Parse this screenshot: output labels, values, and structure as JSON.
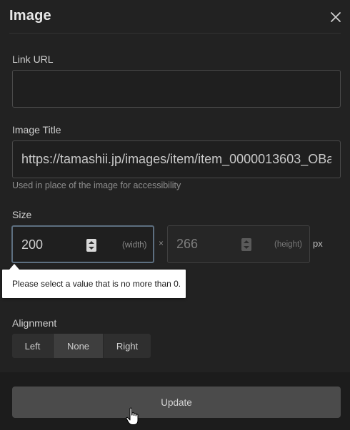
{
  "dialog": {
    "title": "Image"
  },
  "link": {
    "label": "Link URL",
    "value": "",
    "placeholder": ""
  },
  "image_title": {
    "label": "Image Title",
    "value": "https://tamashii.jp/images/item/item_0000013603_OBa",
    "hint": "Used in place of the image for accessibility"
  },
  "size": {
    "label": "Size",
    "width_value": "200",
    "width_note": "(width)",
    "separator": "×",
    "height_value": "266",
    "height_note": "(height)",
    "unit": "px"
  },
  "validation": {
    "message": "Please select a value that is no more than 0."
  },
  "alignment": {
    "label": "Alignment",
    "options": [
      "Left",
      "None",
      "Right"
    ],
    "selected": "None"
  },
  "footer": {
    "update_label": "Update"
  },
  "icons": {
    "close": "close-icon",
    "cursor": "hand-pointer-cursor"
  }
}
